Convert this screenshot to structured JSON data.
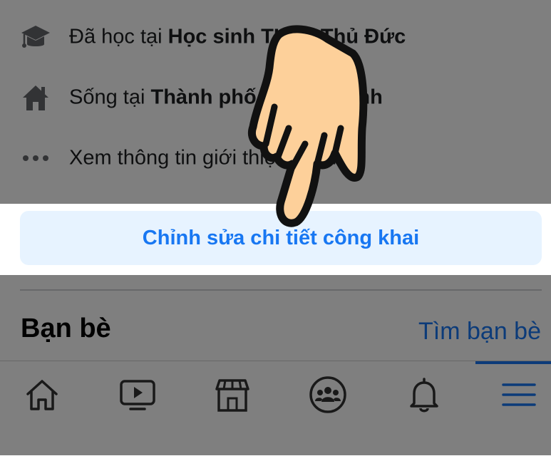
{
  "about": {
    "education": {
      "prefix": "Đã học tại ",
      "place": "Học sinh THPT Thủ Đức",
      "icon": "graduation-cap-icon"
    },
    "residence": {
      "prefix": "Sống tại ",
      "place": "Thành phố Hồ Chí Minh",
      "icon": "home-icon"
    },
    "more": {
      "label": "Xem thông tin giới thiệu của bạn",
      "icon": "more-dots-icon"
    }
  },
  "edit_button_label": "Chỉnh sửa chi tiết công khai",
  "friends": {
    "title": "Bạn bè",
    "find_label": "Tìm bạn bè"
  },
  "tabbar": {
    "tabs": [
      "home-icon",
      "watch-icon",
      "marketplace-icon",
      "groups-icon",
      "notifications-icon",
      "menu-icon"
    ],
    "active": "menu-icon"
  },
  "colors": {
    "accent": "#1877f2",
    "button_bg": "#e7f3ff",
    "overlay": "rgba(0,0,0,0.5)",
    "hand_fill": "#fdd09a"
  }
}
